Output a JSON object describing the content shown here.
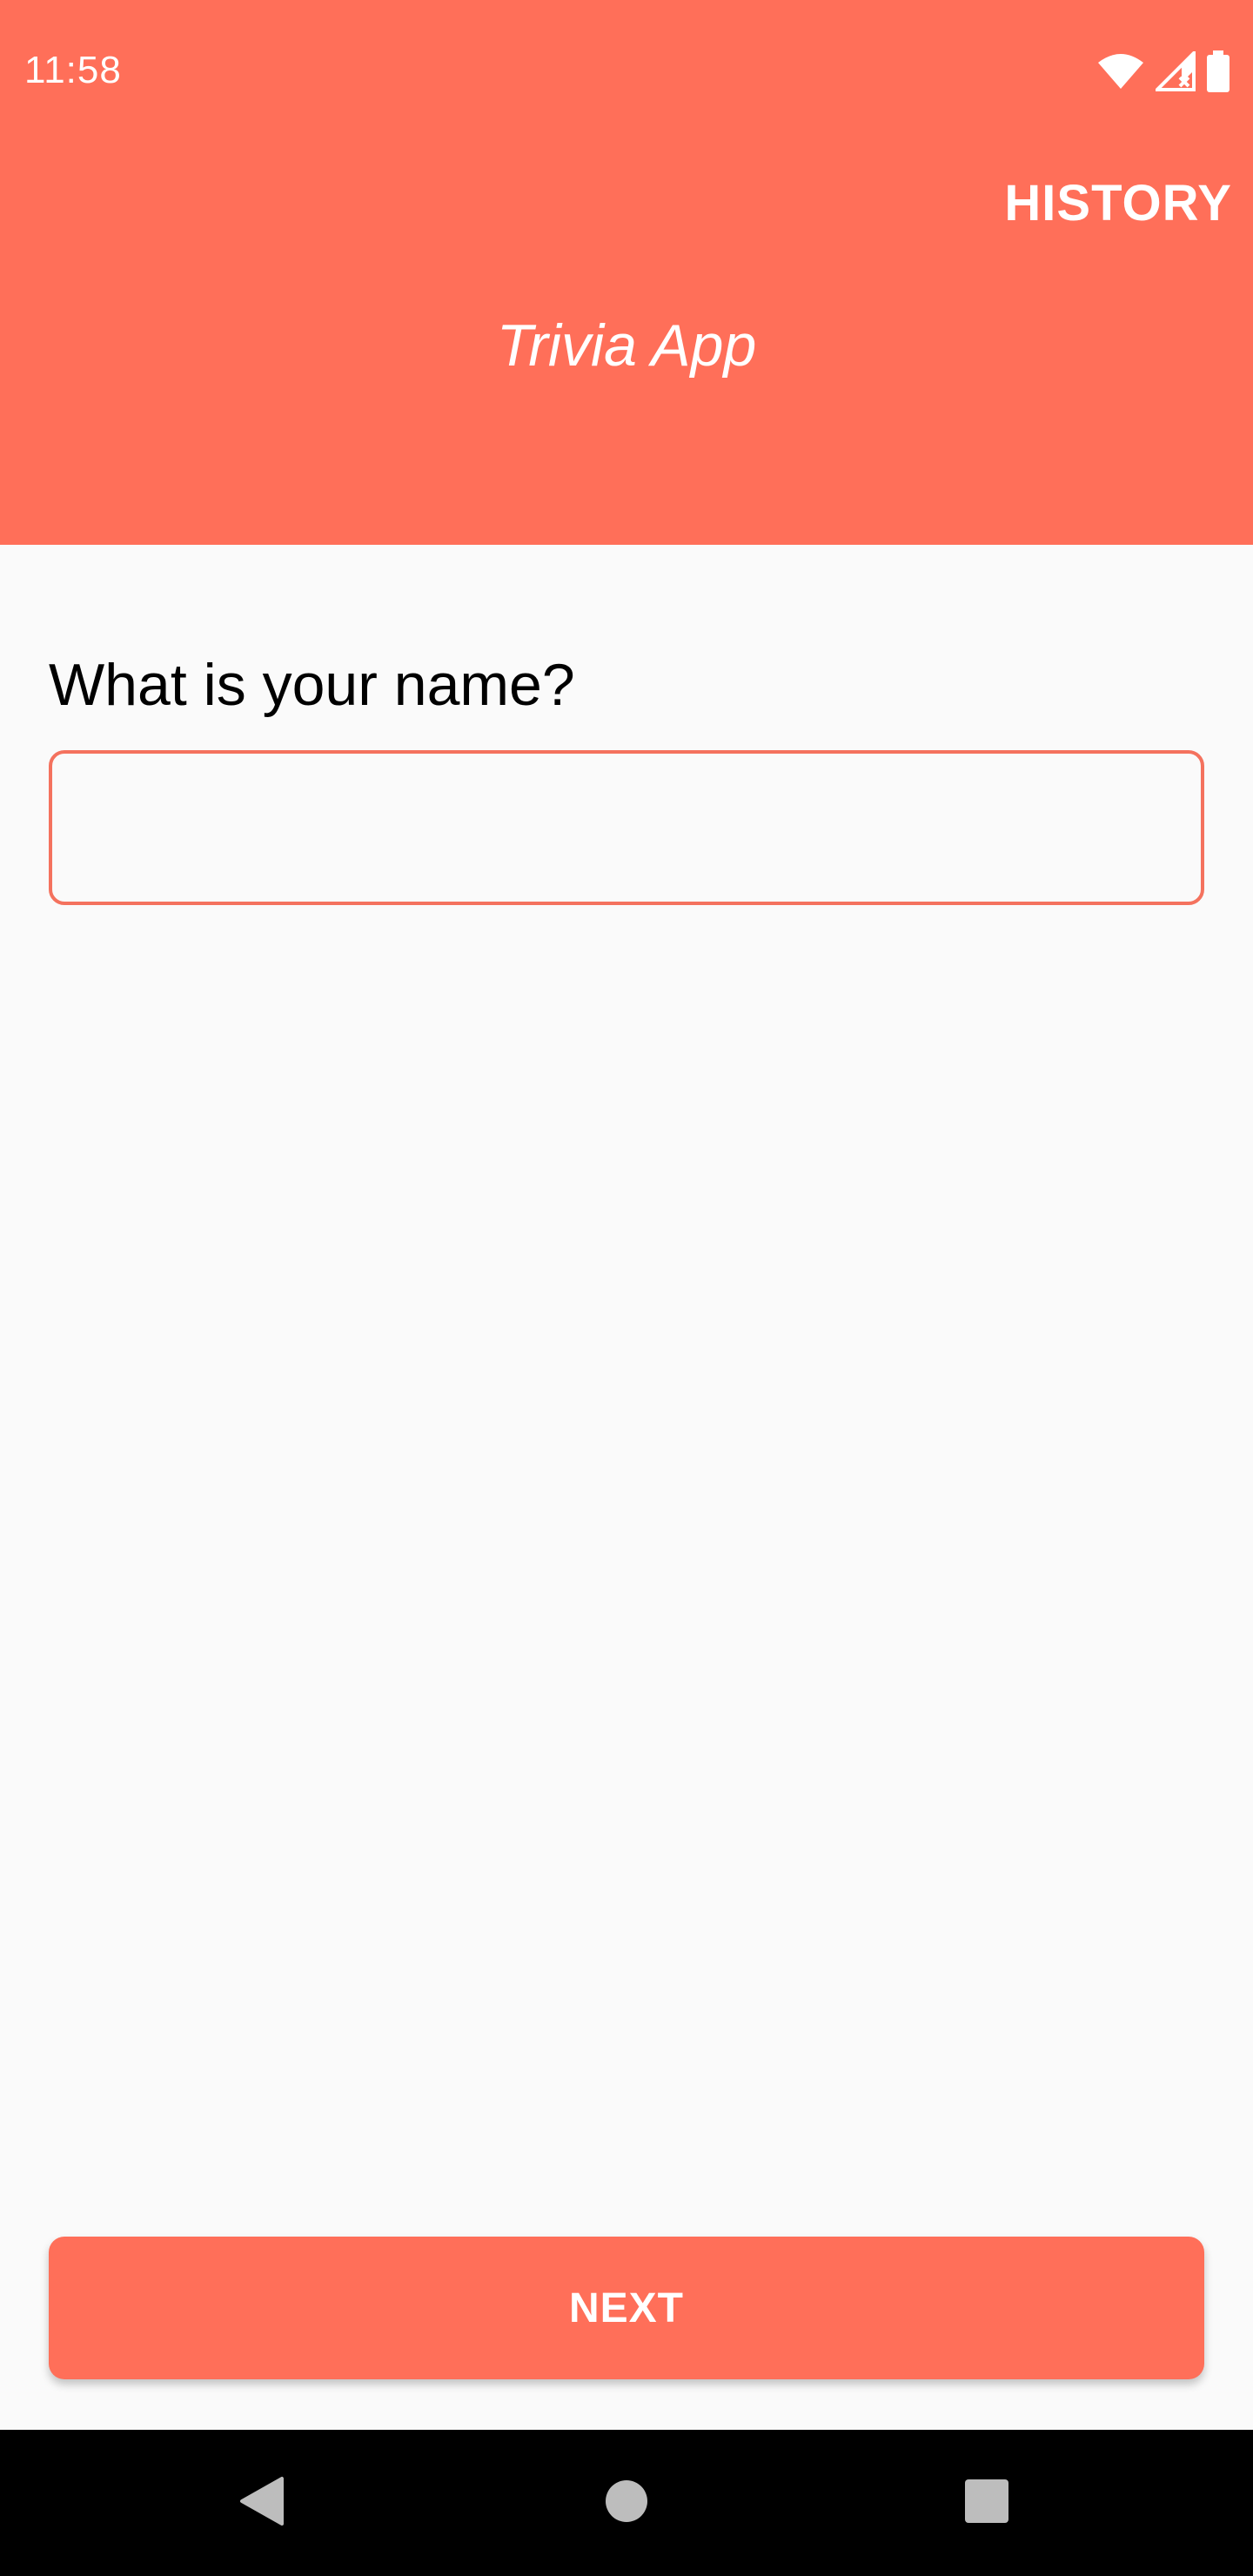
{
  "status_bar": {
    "time": "11:58",
    "icons": [
      "wifi-icon",
      "cell-signal-icon",
      "battery-icon"
    ]
  },
  "app_bar": {
    "action_label": "HISTORY",
    "title": "Trivia App"
  },
  "form": {
    "question": "What is your name?",
    "name_value": "",
    "name_placeholder": ""
  },
  "footer": {
    "next_label": "NEXT"
  },
  "nav_bar": {
    "buttons": [
      "back-icon",
      "home-icon",
      "recents-icon"
    ]
  },
  "colors": {
    "accent": "#FF6F59",
    "background": "#FAFAFA",
    "nav_bar": "#000000"
  }
}
